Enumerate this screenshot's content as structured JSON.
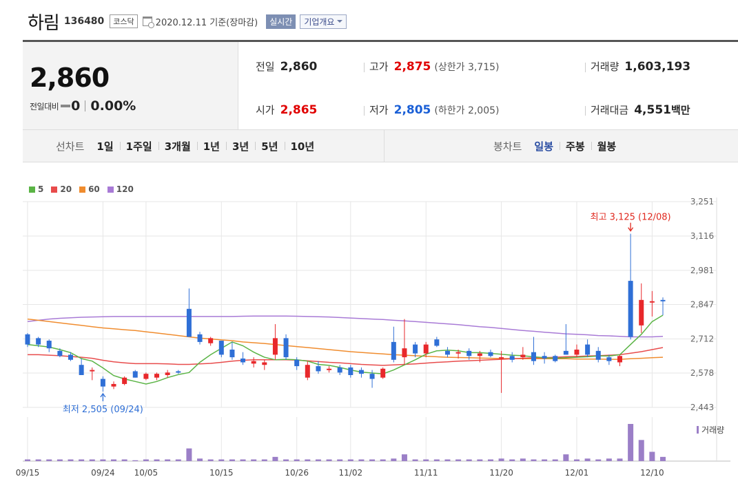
{
  "header": {
    "stock_name": "하림",
    "stock_code": "136480",
    "market": "코스닥",
    "ref_date": "2020.12.11 기준(장마감)",
    "realtime_label": "실시간",
    "company_label": "기업개요",
    "icons": {
      "calendar": "calendar-icon",
      "dropdown": "triangle-down-icon"
    }
  },
  "price": {
    "current": "2,860",
    "change_label": "전일대비",
    "change_value": "0",
    "change_pct": "0.00%",
    "prev_label": "전일",
    "prev": "2,860",
    "high_label": "고가",
    "high": "2,875",
    "upper_limit": "(상한가 3,715)",
    "volume_label": "거래량",
    "volume": "1,603,193",
    "open_label": "시가",
    "open": "2,865",
    "low_label": "저가",
    "low": "2,805",
    "lower_limit": "(하한가 2,005)",
    "amount_label": "거래대금",
    "amount": "4,551",
    "amount_unit": "백만"
  },
  "periods": {
    "line_label": "선차트",
    "line_items": [
      "1일",
      "1주일",
      "3개월",
      "1년",
      "3년",
      "5년",
      "10년"
    ],
    "candle_label": "봉차트",
    "candle_items": [
      "일봉",
      "주봉",
      "월봉"
    ],
    "candle_active": 0
  },
  "colors": {
    "up": "#e8282b",
    "down": "#2f6fd6",
    "ma5": "#5ab445",
    "ma20": "#e84b4b",
    "ma60": "#f08c2e",
    "ma120": "#a87ad6",
    "volume": "#9b7fc7",
    "grid": "#e6e6e6"
  },
  "chart_data": {
    "type": "candlestick",
    "legend": [
      {
        "name": "5",
        "color": "#5ab445"
      },
      {
        "name": "20",
        "color": "#e84b4b"
      },
      {
        "name": "60",
        "color": "#f08c2e"
      },
      {
        "name": "120",
        "color": "#a87ad6"
      }
    ],
    "y_ticks": [
      "3,251",
      "3,116",
      "2,981",
      "2,847",
      "2,712",
      "2,578",
      "2,443"
    ],
    "ylim": [
      2443,
      3251
    ],
    "x_ticks": [
      {
        "label": "09/15",
        "index": 0
      },
      {
        "label": "09/24",
        "index": 7
      },
      {
        "label": "10/05",
        "index": 11
      },
      {
        "label": "10/15",
        "index": 18
      },
      {
        "label": "10/26",
        "index": 25
      },
      {
        "label": "11/02",
        "index": 30
      },
      {
        "label": "11/11",
        "index": 37
      },
      {
        "label": "11/20",
        "index": 44
      },
      {
        "label": "12/01",
        "index": 51
      },
      {
        "label": "12/10",
        "index": 58
      }
    ],
    "annotations": {
      "high": {
        "text": "최고 3,125 (12/08)",
        "index": 56,
        "value": 3125
      },
      "low": {
        "text": "최저 2,505 (09/24)",
        "index": 7,
        "value": 2505
      }
    },
    "volume_label": "거래량",
    "candles": [
      {
        "o": 2730,
        "h": 2735,
        "l": 2680,
        "c": 2690
      },
      {
        "o": 2715,
        "h": 2720,
        "l": 2680,
        "c": 2690
      },
      {
        "o": 2705,
        "h": 2710,
        "l": 2660,
        "c": 2675
      },
      {
        "o": 2665,
        "h": 2675,
        "l": 2640,
        "c": 2645
      },
      {
        "o": 2650,
        "h": 2660,
        "l": 2625,
        "c": 2630
      },
      {
        "o": 2610,
        "h": 2635,
        "l": 2570,
        "c": 2570
      },
      {
        "o": 2590,
        "h": 2600,
        "l": 2550,
        "c": 2590
      },
      {
        "o": 2555,
        "h": 2565,
        "l": 2505,
        "c": 2525
      },
      {
        "o": 2525,
        "h": 2545,
        "l": 2515,
        "c": 2535
      },
      {
        "o": 2535,
        "h": 2565,
        "l": 2530,
        "c": 2560
      },
      {
        "o": 2585,
        "h": 2590,
        "l": 2560,
        "c": 2560
      },
      {
        "o": 2555,
        "h": 2580,
        "l": 2550,
        "c": 2575
      },
      {
        "o": 2560,
        "h": 2580,
        "l": 2550,
        "c": 2575
      },
      {
        "o": 2570,
        "h": 2590,
        "l": 2560,
        "c": 2580
      },
      {
        "o": 2585,
        "h": 2590,
        "l": 2575,
        "c": 2580
      },
      {
        "o": 2830,
        "h": 2910,
        "l": 2720,
        "c": 2720
      },
      {
        "o": 2730,
        "h": 2740,
        "l": 2690,
        "c": 2700
      },
      {
        "o": 2695,
        "h": 2720,
        "l": 2685,
        "c": 2715
      },
      {
        "o": 2705,
        "h": 2705,
        "l": 2640,
        "c": 2650
      },
      {
        "o": 2670,
        "h": 2700,
        "l": 2630,
        "c": 2640
      },
      {
        "o": 2635,
        "h": 2660,
        "l": 2610,
        "c": 2620
      },
      {
        "o": 2615,
        "h": 2640,
        "l": 2600,
        "c": 2625
      },
      {
        "o": 2610,
        "h": 2630,
        "l": 2590,
        "c": 2620
      },
      {
        "o": 2650,
        "h": 2770,
        "l": 2630,
        "c": 2715
      },
      {
        "o": 2715,
        "h": 2730,
        "l": 2630,
        "c": 2640
      },
      {
        "o": 2630,
        "h": 2640,
        "l": 2590,
        "c": 2605
      },
      {
        "o": 2560,
        "h": 2625,
        "l": 2550,
        "c": 2610
      },
      {
        "o": 2605,
        "h": 2625,
        "l": 2575,
        "c": 2585
      },
      {
        "o": 2595,
        "h": 2605,
        "l": 2580,
        "c": 2595
      },
      {
        "o": 2600,
        "h": 2610,
        "l": 2570,
        "c": 2580
      },
      {
        "o": 2600,
        "h": 2610,
        "l": 2560,
        "c": 2570
      },
      {
        "o": 2590,
        "h": 2600,
        "l": 2560,
        "c": 2575
      },
      {
        "o": 2575,
        "h": 2590,
        "l": 2520,
        "c": 2555
      },
      {
        "o": 2560,
        "h": 2600,
        "l": 2555,
        "c": 2595
      },
      {
        "o": 2700,
        "h": 2760,
        "l": 2620,
        "c": 2630
      },
      {
        "o": 2640,
        "h": 2790,
        "l": 2610,
        "c": 2675
      },
      {
        "o": 2690,
        "h": 2700,
        "l": 2640,
        "c": 2655
      },
      {
        "o": 2655,
        "h": 2700,
        "l": 2640,
        "c": 2690
      },
      {
        "o": 2710,
        "h": 2720,
        "l": 2680,
        "c": 2685
      },
      {
        "o": 2665,
        "h": 2680,
        "l": 2640,
        "c": 2650
      },
      {
        "o": 2655,
        "h": 2670,
        "l": 2635,
        "c": 2660
      },
      {
        "o": 2665,
        "h": 2675,
        "l": 2630,
        "c": 2645
      },
      {
        "o": 2645,
        "h": 2665,
        "l": 2620,
        "c": 2655
      },
      {
        "o": 2660,
        "h": 2670,
        "l": 2640,
        "c": 2645
      },
      {
        "o": 2635,
        "h": 2665,
        "l": 2500,
        "c": 2640
      },
      {
        "o": 2645,
        "h": 2660,
        "l": 2620,
        "c": 2630
      },
      {
        "o": 2640,
        "h": 2680,
        "l": 2630,
        "c": 2650
      },
      {
        "o": 2660,
        "h": 2720,
        "l": 2610,
        "c": 2625
      },
      {
        "o": 2645,
        "h": 2660,
        "l": 2615,
        "c": 2635
      },
      {
        "o": 2645,
        "h": 2650,
        "l": 2620,
        "c": 2625
      },
      {
        "o": 2665,
        "h": 2770,
        "l": 2650,
        "c": 2650
      },
      {
        "o": 2650,
        "h": 2690,
        "l": 2640,
        "c": 2670
      },
      {
        "o": 2690,
        "h": 2710,
        "l": 2640,
        "c": 2650
      },
      {
        "o": 2665,
        "h": 2680,
        "l": 2620,
        "c": 2630
      },
      {
        "o": 2640,
        "h": 2650,
        "l": 2610,
        "c": 2625
      },
      {
        "o": 2620,
        "h": 2650,
        "l": 2605,
        "c": 2645
      },
      {
        "o": 2940,
        "h": 3125,
        "l": 2710,
        "c": 2720
      },
      {
        "o": 2765,
        "h": 2930,
        "l": 2735,
        "c": 2865
      },
      {
        "o": 2860,
        "h": 2900,
        "l": 2800,
        "c": 2860
      },
      {
        "o": 2865,
        "h": 2875,
        "l": 2805,
        "c": 2860
      }
    ],
    "volumes": [
      1,
      1,
      1,
      1,
      1,
      1,
      1,
      1,
      1,
      1,
      0.5,
      1,
      1,
      1,
      1,
      7.5,
      1.5,
      1,
      1,
      1,
      1,
      1,
      1,
      2.5,
      1,
      1,
      1,
      1,
      1,
      1,
      1,
      1,
      1,
      1,
      1.5,
      4,
      1,
      1,
      1,
      1,
      1,
      1,
      1,
      1,
      1.5,
      1,
      1.5,
      1,
      1,
      1,
      4,
      1,
      1.5,
      1,
      1.5,
      1.5,
      22,
      12.5,
      5.5,
      2.5
    ],
    "ma": {
      "5": [
        2690,
        2685,
        2680,
        2670,
        2658,
        2635,
        2625,
        2598,
        2568,
        2555,
        2545,
        2535,
        2545,
        2560,
        2572,
        2580,
        2620,
        2650,
        2675,
        2700,
        2685,
        2660,
        2640,
        2630,
        2632,
        2630,
        2625,
        2612,
        2608,
        2600,
        2590,
        2582,
        2578,
        2575,
        2590,
        2610,
        2630,
        2652,
        2665,
        2668,
        2665,
        2658,
        2658,
        2655,
        2652,
        2648,
        2646,
        2642,
        2638,
        2636,
        2638,
        2640,
        2642,
        2645,
        2645,
        2650,
        2690,
        2730,
        2780,
        2805
      ],
      "20": [
        2650,
        2650,
        2648,
        2646,
        2643,
        2640,
        2636,
        2628,
        2622,
        2618,
        2615,
        2615,
        2615,
        2614,
        2612,
        2612,
        2614,
        2616,
        2620,
        2625,
        2628,
        2630,
        2630,
        2630,
        2630,
        2629,
        2626,
        2623,
        2620,
        2618,
        2615,
        2612,
        2610,
        2608,
        2610,
        2612,
        2614,
        2617,
        2620,
        2622,
        2625,
        2626,
        2628,
        2630,
        2632,
        2634,
        2636,
        2638,
        2638,
        2640,
        2642,
        2643,
        2645,
        2646,
        2648,
        2650,
        2656,
        2662,
        2670,
        2678
      ],
      "60": [
        2790,
        2785,
        2780,
        2775,
        2770,
        2765,
        2760,
        2755,
        2752,
        2748,
        2745,
        2740,
        2735,
        2730,
        2725,
        2720,
        2715,
        2712,
        2708,
        2705,
        2700,
        2697,
        2694,
        2690,
        2686,
        2682,
        2678,
        2674,
        2670,
        2666,
        2662,
        2659,
        2656,
        2653,
        2650,
        2648,
        2646,
        2644,
        2642,
        2640,
        2639,
        2638,
        2637,
        2636,
        2635,
        2635,
        2634,
        2634,
        2634,
        2634,
        2634,
        2633,
        2633,
        2633,
        2632,
        2632,
        2634,
        2636,
        2638,
        2640
      ],
      "120": [
        2780,
        2785,
        2790,
        2793,
        2795,
        2797,
        2798,
        2799,
        2800,
        2800,
        2800,
        2800,
        2800,
        2800,
        2800,
        2800,
        2800,
        2800,
        2800,
        2800,
        2801,
        2802,
        2802,
        2802,
        2802,
        2801,
        2800,
        2799,
        2798,
        2796,
        2794,
        2792,
        2790,
        2788,
        2785,
        2783,
        2780,
        2777,
        2774,
        2771,
        2768,
        2764,
        2760,
        2757,
        2753,
        2749,
        2745,
        2742,
        2738,
        2735,
        2732,
        2730,
        2728,
        2725,
        2724,
        2722,
        2720,
        2720,
        2720,
        2722
      ]
    }
  }
}
